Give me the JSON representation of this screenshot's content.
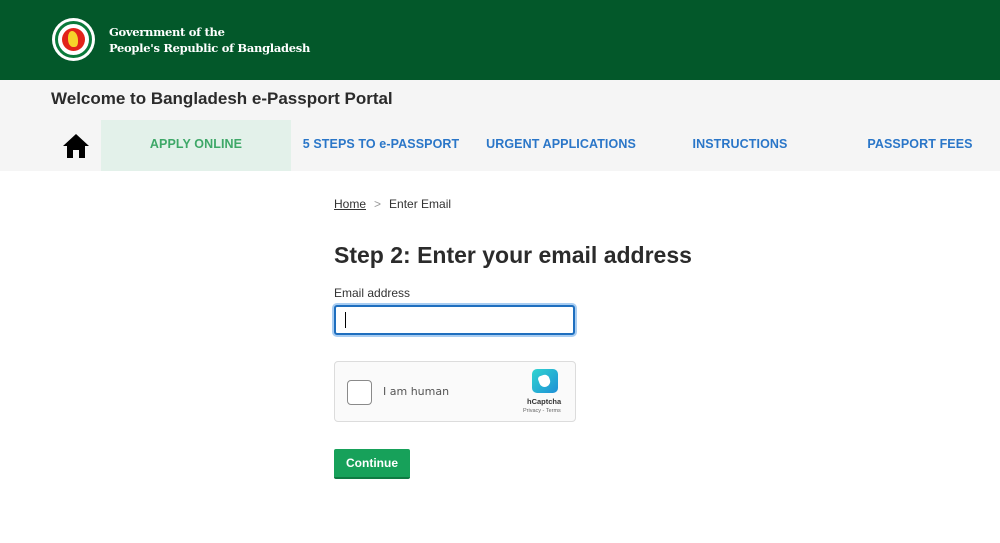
{
  "header": {
    "gov_line1": "Government of the",
    "gov_line2": "People's Republic of Bangladesh",
    "brand_color": "#03582a"
  },
  "portal": {
    "welcome": "Welcome to Bangladesh e-Passport Portal"
  },
  "nav": {
    "home_icon": "home-icon",
    "items": [
      {
        "label": "APPLY ONLINE",
        "active": true
      },
      {
        "label": "5 STEPS TO e-PASSPORT",
        "active": false
      },
      {
        "label": "URGENT APPLICATIONS",
        "active": false
      },
      {
        "label": "INSTRUCTIONS",
        "active": false
      },
      {
        "label": "PASSPORT FEES",
        "active": false
      }
    ]
  },
  "breadcrumb": {
    "home": "Home",
    "separator": ">",
    "current": "Enter Email"
  },
  "form": {
    "title": "Step 2: Enter your email address",
    "email_label": "Email address",
    "email_value": "",
    "captcha_label": "I am human",
    "captcha_brand": "hCaptcha",
    "captcha_links": "Privacy - Terms",
    "continue_label": "Continue",
    "continue_color": "#17a15a"
  }
}
